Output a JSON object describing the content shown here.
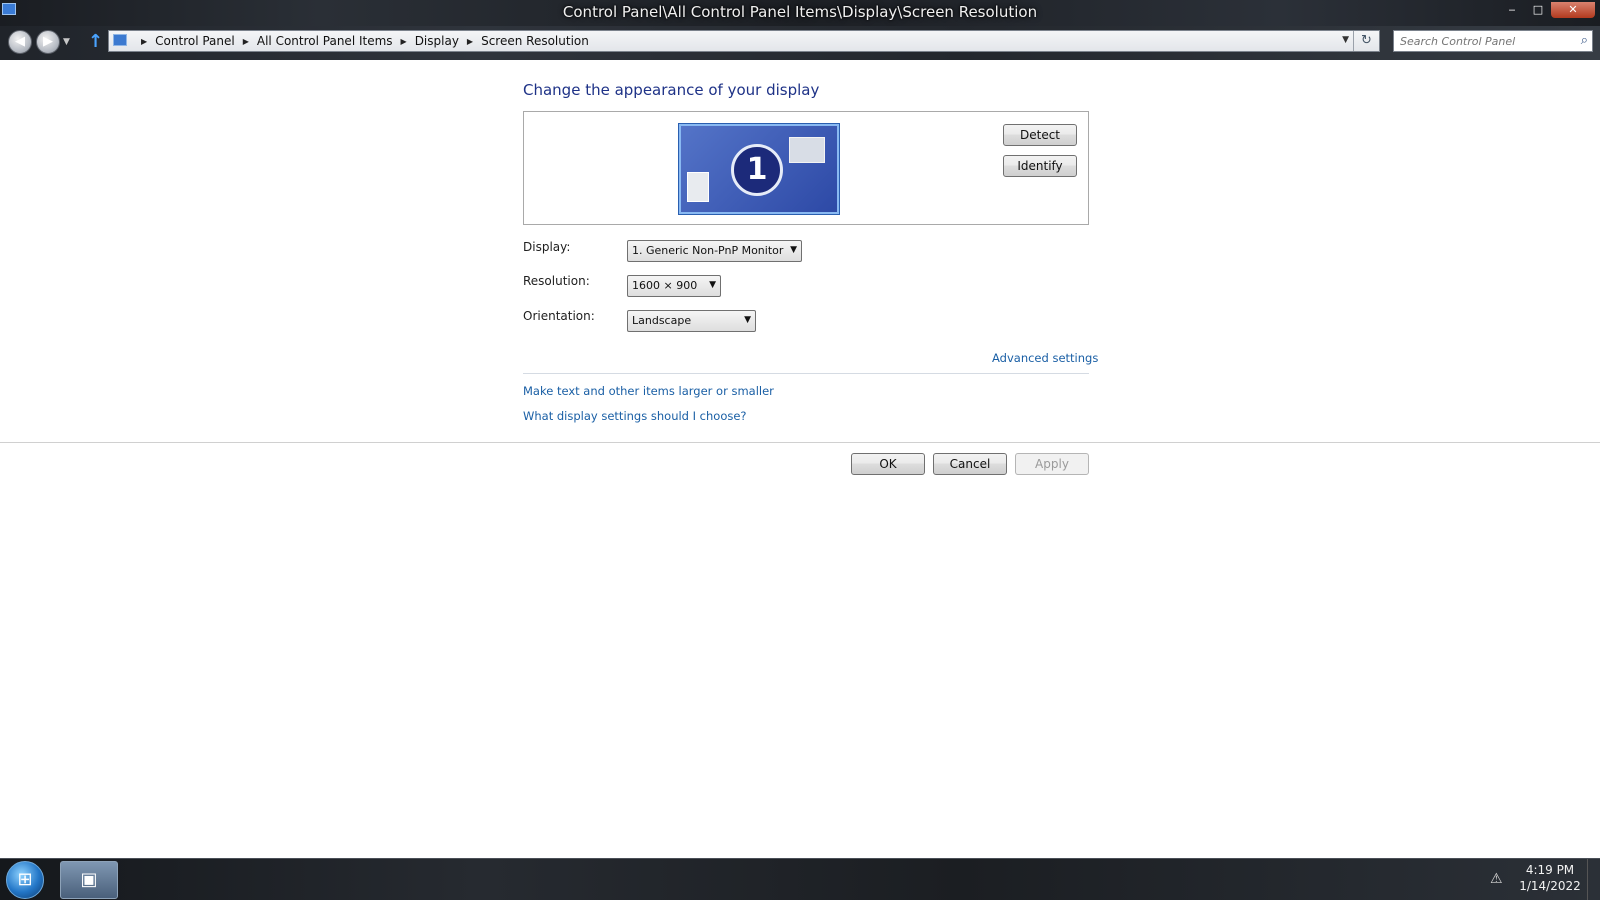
{
  "window": {
    "title": "Control Panel\\All Control Panel Items\\Display\\Screen Resolution",
    "controls": {
      "minimize": "‒",
      "maximize": "□",
      "close": "✕"
    }
  },
  "nav": {
    "back_icon": "◀",
    "forward_icon": "▶",
    "history_icon": "▼",
    "up_icon": "↑",
    "breadcrumbs": [
      "Control Panel",
      "All Control Panel Items",
      "Display",
      "Screen Resolution"
    ],
    "separator": "▶",
    "dropdown_icon": "▼",
    "refresh_icon": "↻",
    "search_placeholder": "Search Control Panel",
    "search_icon": "⌕"
  },
  "page": {
    "title": "Change the appearance of your display",
    "monitor_number": "1",
    "detect_label": "Detect",
    "identify_label": "Identify",
    "display_label": "Display:",
    "display_value": "1. Generic Non-PnP Monitor",
    "resolution_label": "Resolution:",
    "resolution_value": "1600 × 900",
    "orientation_label": "Orientation:",
    "orientation_value": "Landscape",
    "select_arrow": "▼",
    "advanced_link": "Advanced settings",
    "text_size_link": "Make text and other items larger or smaller",
    "help_link": "What display settings should I choose?",
    "ok_label": "OK",
    "cancel_label": "Cancel",
    "apply_label": "Apply"
  },
  "taskbar": {
    "start_icon": "⊞",
    "task_icon": "▣",
    "tray_icon": "⚠",
    "time": "4:19 PM",
    "date": "1/14/2022"
  }
}
